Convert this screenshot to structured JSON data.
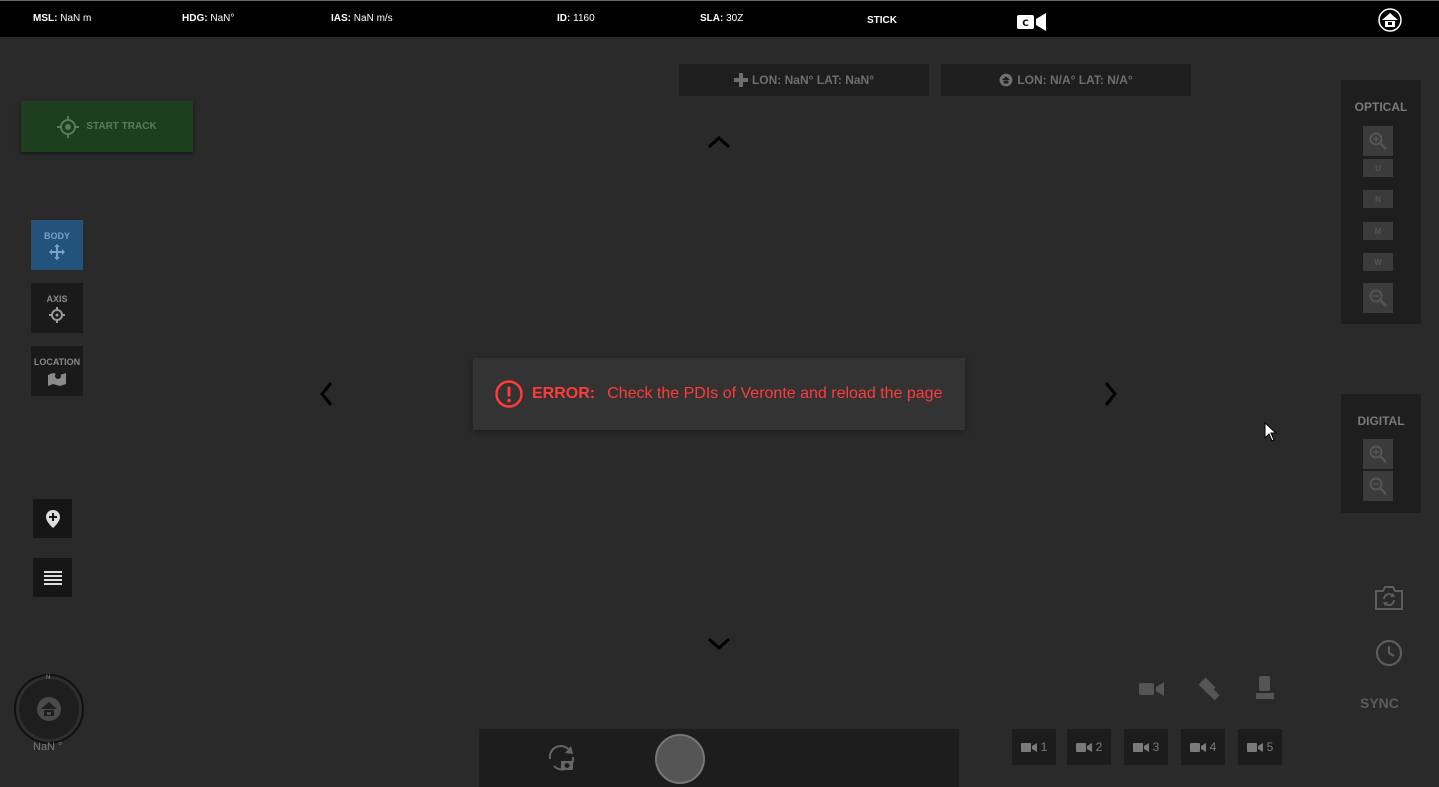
{
  "topbar": {
    "msl_label": "MSL:",
    "msl_value": "NaN  m",
    "hdg_label": "HDG:",
    "hdg_value": "NaN°",
    "ias_label": "IAS:",
    "ias_value": "NaN  m/s",
    "id_label": "ID:",
    "id_value": "1160",
    "sla_label": "SLA:",
    "sla_value": "30Z",
    "mode": "STICK",
    "camera_letter": "C"
  },
  "coords": {
    "target": "LON: NaN°   LAT: NaN°",
    "vehicle": "LON: N/A°   LAT: N/A°"
  },
  "start_track": "START TRACK",
  "modes": [
    {
      "label": "BODY"
    },
    {
      "label": "AXIS"
    },
    {
      "label": "LOCATION"
    }
  ],
  "compass": {
    "north": "N",
    "value": "NaN °"
  },
  "error": {
    "label": "ERROR:",
    "message": "Check the PDIs of Veronte and reload the page",
    "color": "#ff3b3b"
  },
  "optical": {
    "title": "OPTICAL",
    "levels": [
      "U",
      "N",
      "M",
      "W"
    ]
  },
  "digital": {
    "title": "DIGITAL"
  },
  "sync_label": "SYNC",
  "cameras": [
    "1",
    "2",
    "3",
    "4",
    "5"
  ],
  "icons": {
    "camera": "video-camera-icon",
    "gimbal": "gimbal-icon",
    "payload": "payload-icon",
    "snapshot_rotate": "camera-rotate-icon",
    "clock": "clock-icon"
  }
}
